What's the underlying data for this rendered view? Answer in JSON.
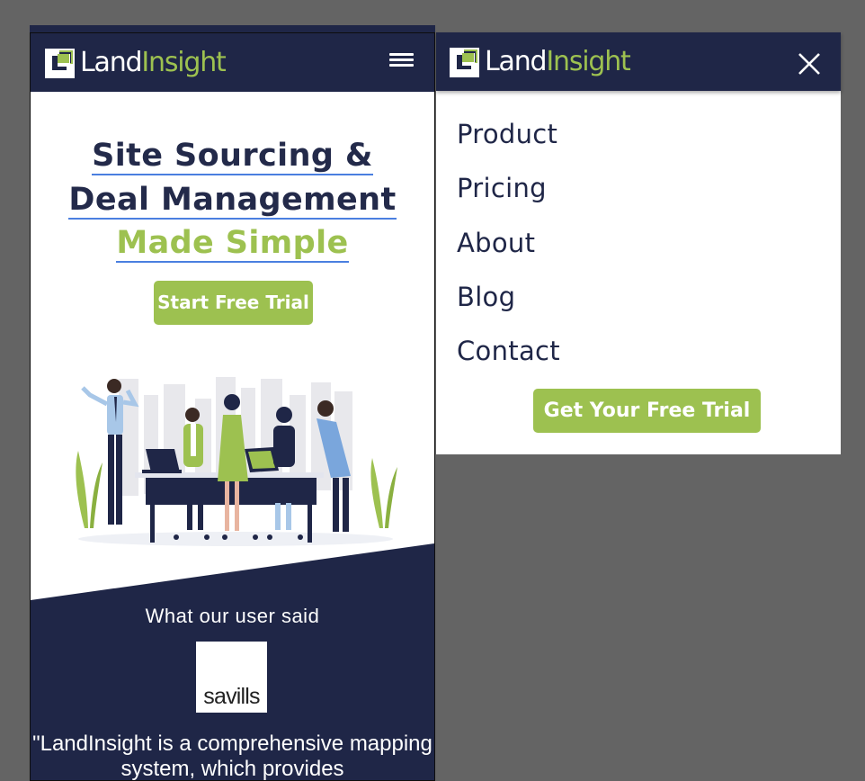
{
  "brand": {
    "land": "Land",
    "insight": "Insight"
  },
  "colors": {
    "navy": "#1f2647",
    "green": "#9dc150",
    "overlay": "#646464"
  },
  "icons": {
    "menu": "hamburger-icon",
    "close": "close-icon",
    "logo": "landinsight-logo-icon"
  },
  "hero": {
    "line1": "Site Sourcing &",
    "line2": "Deal Management",
    "line3": "Made Simple",
    "cta": "Start Free Trial"
  },
  "testimonial": {
    "heading": "What our user said",
    "company_logo": "savills",
    "quote": "\"LandInsight is a comprehensive mapping system, which provides"
  },
  "menu": {
    "items": [
      {
        "label": "Product"
      },
      {
        "label": "Pricing"
      },
      {
        "label": "About"
      },
      {
        "label": "Blog"
      },
      {
        "label": "Contact"
      }
    ],
    "cta": "Get Your Free Trial"
  }
}
